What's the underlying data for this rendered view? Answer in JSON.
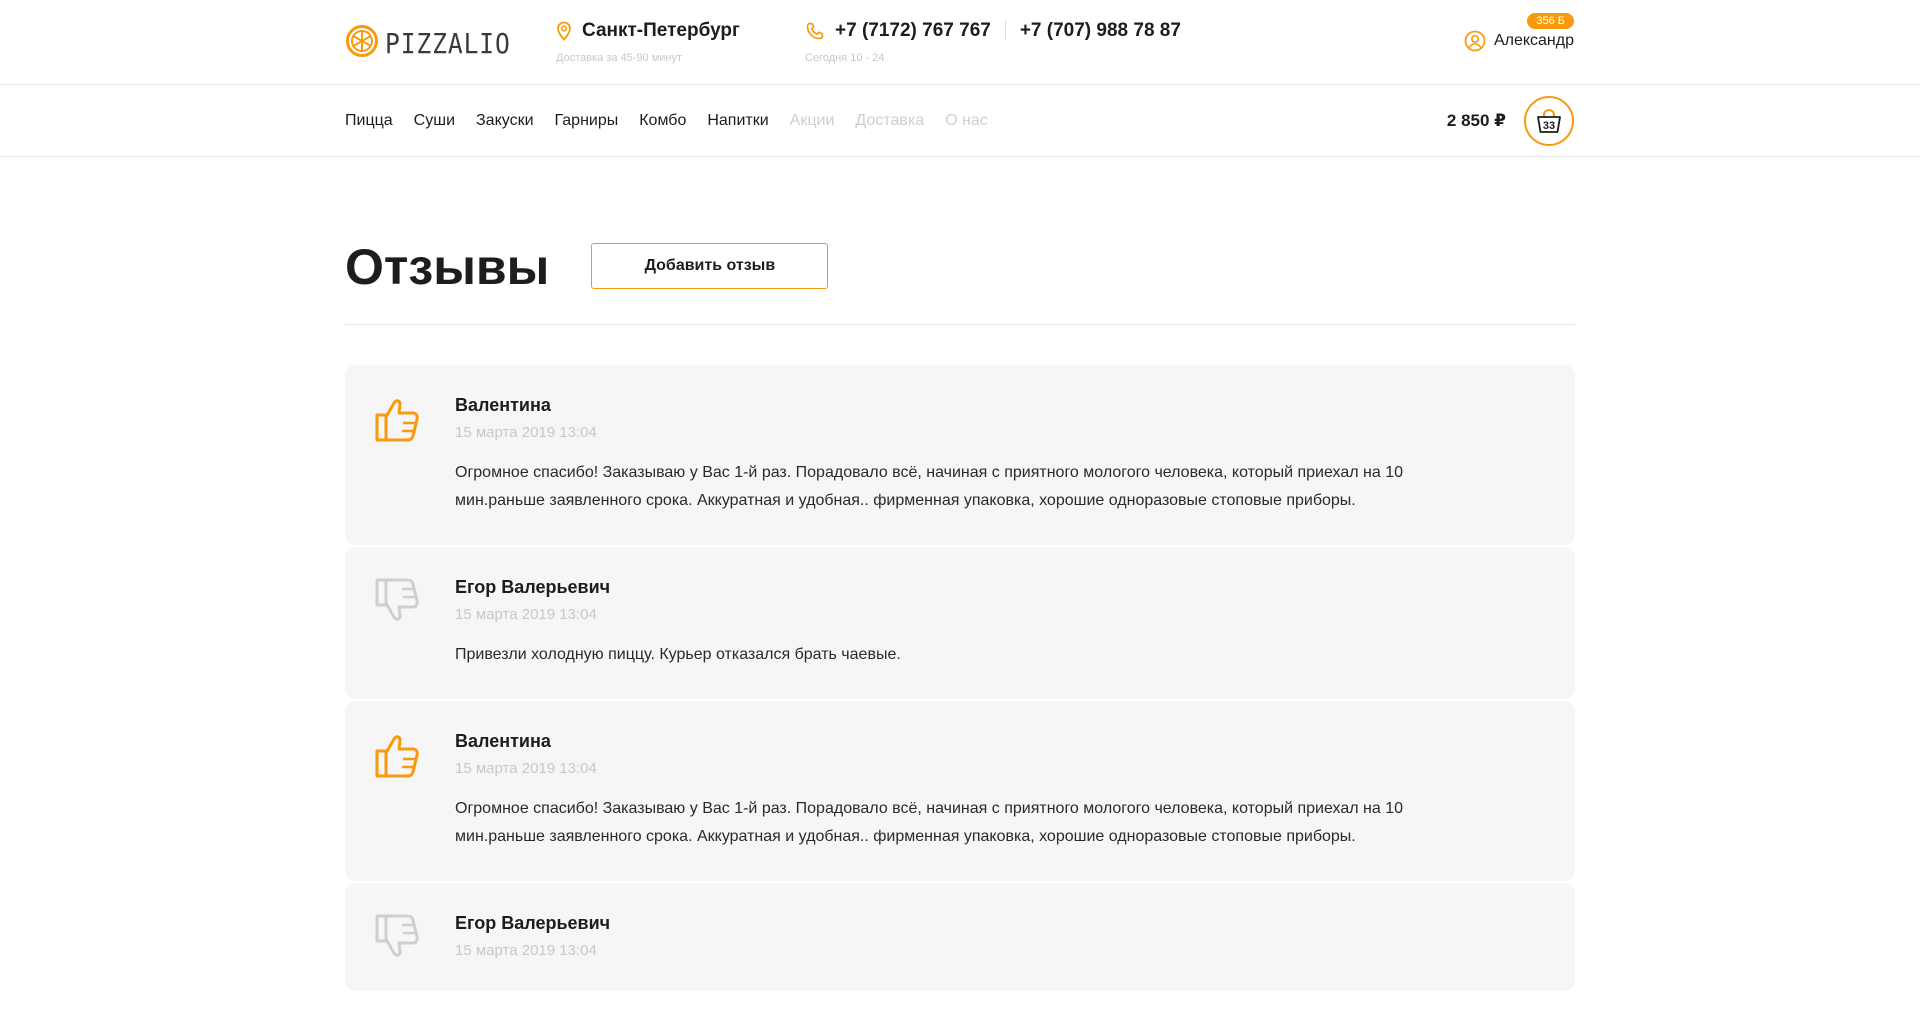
{
  "brand": {
    "name": "PIZZALIO"
  },
  "header": {
    "city": "Санкт-Петербург",
    "delivery_time": "Доставка за 45-90 минут",
    "phone1": "+7 (7172) 767 767",
    "phone2": "+7 (707) 988 78 87",
    "hours": "Сегодня 10 - 24",
    "user_name": "Александр",
    "bonus": "356 Б"
  },
  "nav": {
    "items": [
      {
        "label": "Пицца",
        "muted": false
      },
      {
        "label": "Суши",
        "muted": false
      },
      {
        "label": "Закуски",
        "muted": false
      },
      {
        "label": "Гарниры",
        "muted": false
      },
      {
        "label": "Комбо",
        "muted": false
      },
      {
        "label": "Напитки",
        "muted": false
      },
      {
        "label": "Акции",
        "muted": true
      },
      {
        "label": "Доставка",
        "muted": true
      },
      {
        "label": "О нас",
        "muted": true
      }
    ]
  },
  "cart": {
    "total": "2 850 ₽",
    "count": "33"
  },
  "page": {
    "title": "Отзывы",
    "add_button": "Добавить отзыв"
  },
  "reviews": [
    {
      "name": "Валентина",
      "date": "15 марта 2019 13:04",
      "positive": true,
      "text": "Огромное спасибо! Заказываю у Вас 1-й раз. Порадовало всё, начиная с приятного мологого человека, который приехал на 10 мин.раньше заявленного срока. Аккуратная и удобная.. фирменная упаковка, хорошие одноразовые стоповые приборы."
    },
    {
      "name": "Егор Валерьевич",
      "date": "15 марта 2019 13:04",
      "positive": false,
      "text": "Привезли холодную пиццу. Курьер отказался брать чаевые."
    },
    {
      "name": "Валентина",
      "date": "15 марта 2019 13:04",
      "positive": true,
      "text": "Огромное спасибо! Заказываю у Вас 1-й раз. Порадовало всё, начиная с приятного мологого человека, который приехал на 10 мин.раньше заявленного срока. Аккуратная и удобная.. фирменная упаковка, хорошие одноразовые стоповые приборы."
    },
    {
      "name": "Егор Валерьевич",
      "date": "15 марта 2019 13:04",
      "positive": false,
      "text": ""
    }
  ],
  "colors": {
    "accent": "#f89a0c",
    "muted": "#c8c8c8",
    "card_bg": "#f6f6f6",
    "thumb_down": "#cfcfcf"
  },
  "icons": {
    "logo": "pizza-slice-icon",
    "city": "location-pin-icon",
    "phone": "phone-icon",
    "user": "user-icon",
    "cart": "basket-icon",
    "like": "thumbs-up-icon",
    "dislike": "thumbs-down-icon"
  }
}
